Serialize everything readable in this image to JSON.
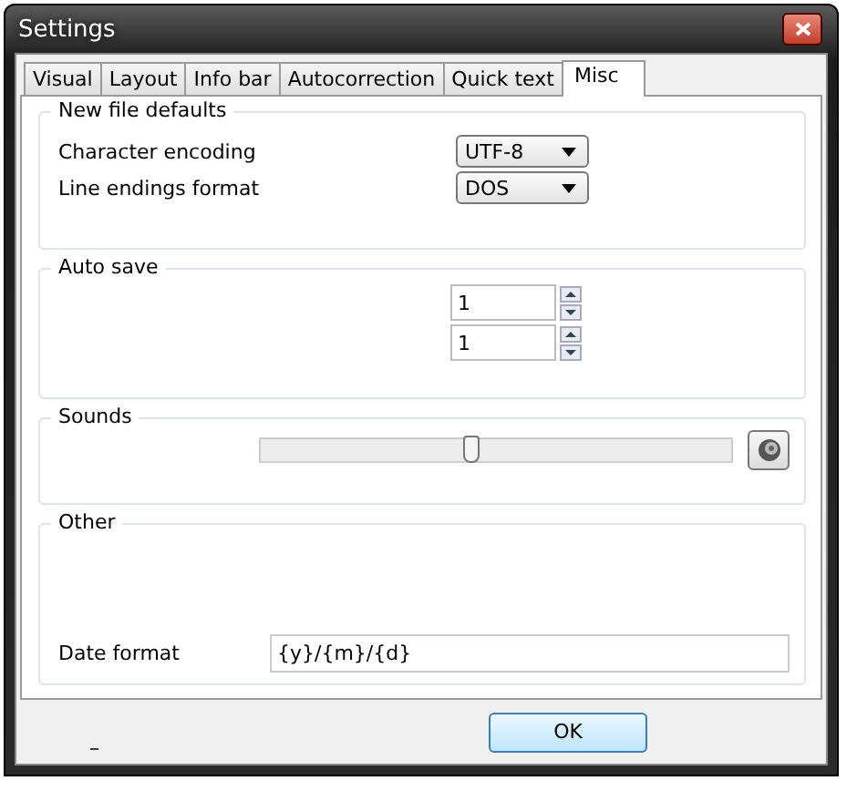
{
  "window": {
    "title": "Settings"
  },
  "tabs": [
    {
      "label": "Visual",
      "selected": false
    },
    {
      "label": "Layout",
      "selected": false
    },
    {
      "label": "Info bar",
      "selected": false
    },
    {
      "label": "Autocorrection",
      "selected": false
    },
    {
      "label": "Quick text",
      "selected": false
    },
    {
      "label": "Misc",
      "selected": true
    }
  ],
  "new_file_defaults": {
    "title": "New file defaults",
    "rows": [
      {
        "label": "Character encoding",
        "value": "UTF-8"
      },
      {
        "label": "Line endings format",
        "value": "DOS"
      }
    ]
  },
  "auto_save": {
    "title": "Auto save",
    "spinners": [
      {
        "value": "1"
      },
      {
        "value": "1"
      }
    ]
  },
  "sounds": {
    "title": "Sounds",
    "level": 0.45
  },
  "other": {
    "title": "Other",
    "date_format": {
      "label": "Date format",
      "value": "{y}/{m}/{d}"
    }
  },
  "footer": {
    "status": "–",
    "ok": "OK"
  }
}
